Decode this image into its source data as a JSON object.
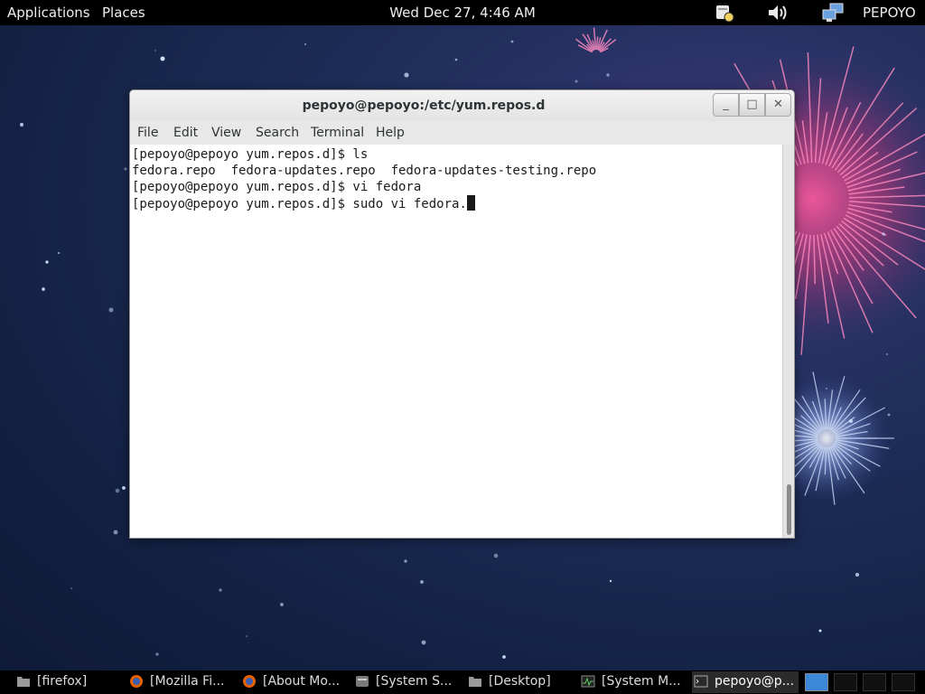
{
  "top_panel": {
    "applications": "Applications",
    "places": "Places",
    "clock": "Wed Dec 27,  4:46 AM",
    "user": "PEPOYO",
    "icons": [
      "notification-icon",
      "volume-icon",
      "network-icon"
    ]
  },
  "window": {
    "title": "pepoyo@pepoyo:/etc/yum.repos.d",
    "buttons": {
      "minimize": "_",
      "maximize": "□",
      "close": "✕"
    },
    "menu": [
      "File",
      "Edit",
      "View",
      "Search",
      "Terminal",
      "Help"
    ]
  },
  "terminal": {
    "lines": [
      "[pepoyo@pepoyo yum.repos.d]$ ls",
      "fedora.repo  fedora-updates.repo  fedora-updates-testing.repo",
      "[pepoyo@pepoyo yum.repos.d]$ vi fedora",
      "[pepoyo@pepoyo yum.repos.d]$ sudo vi fedora."
    ]
  },
  "taskbar": {
    "tasks": [
      {
        "label": "[firefox]",
        "icon": "folder-icon"
      },
      {
        "label": "[Mozilla Fi...",
        "icon": "firefox-icon"
      },
      {
        "label": "[About Mo...",
        "icon": "firefox-icon"
      },
      {
        "label": "[System S...",
        "icon": "settings-icon"
      },
      {
        "label": "[Desktop]",
        "icon": "folder-icon"
      },
      {
        "label": "[System M...",
        "icon": "system-monitor-icon"
      },
      {
        "label": "pepoyo@p...",
        "icon": "terminal-icon"
      }
    ]
  },
  "colors": {
    "panel": "#000000",
    "accent_workspace": "#3c88d8",
    "firework_pink": "#e8488a",
    "firework_blue": "#9fb8ff"
  }
}
